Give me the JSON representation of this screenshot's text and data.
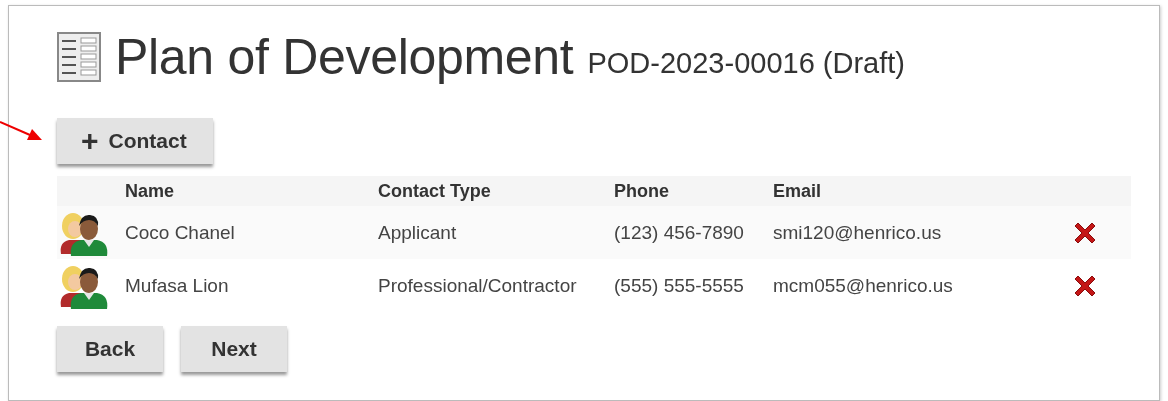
{
  "page": {
    "title": "Plan of Development",
    "subtitle": "POD-2023-00016 (Draft)"
  },
  "add_button": {
    "icon": "+",
    "label": "Contact"
  },
  "table": {
    "columns": [
      "Name",
      "Contact Type",
      "Phone",
      "Email"
    ],
    "rows": [
      {
        "name": "Coco Chanel",
        "contact_type": "Applicant",
        "phone": "(123) 456-7890",
        "email": "smi120@henrico.us"
      },
      {
        "name": "Mufasa Lion",
        "contact_type": "Professional/Contractor",
        "phone": "(555) 555-5555",
        "email": "mcm055@henrico.us"
      }
    ]
  },
  "buttons": [
    "Back",
    "Next"
  ]
}
